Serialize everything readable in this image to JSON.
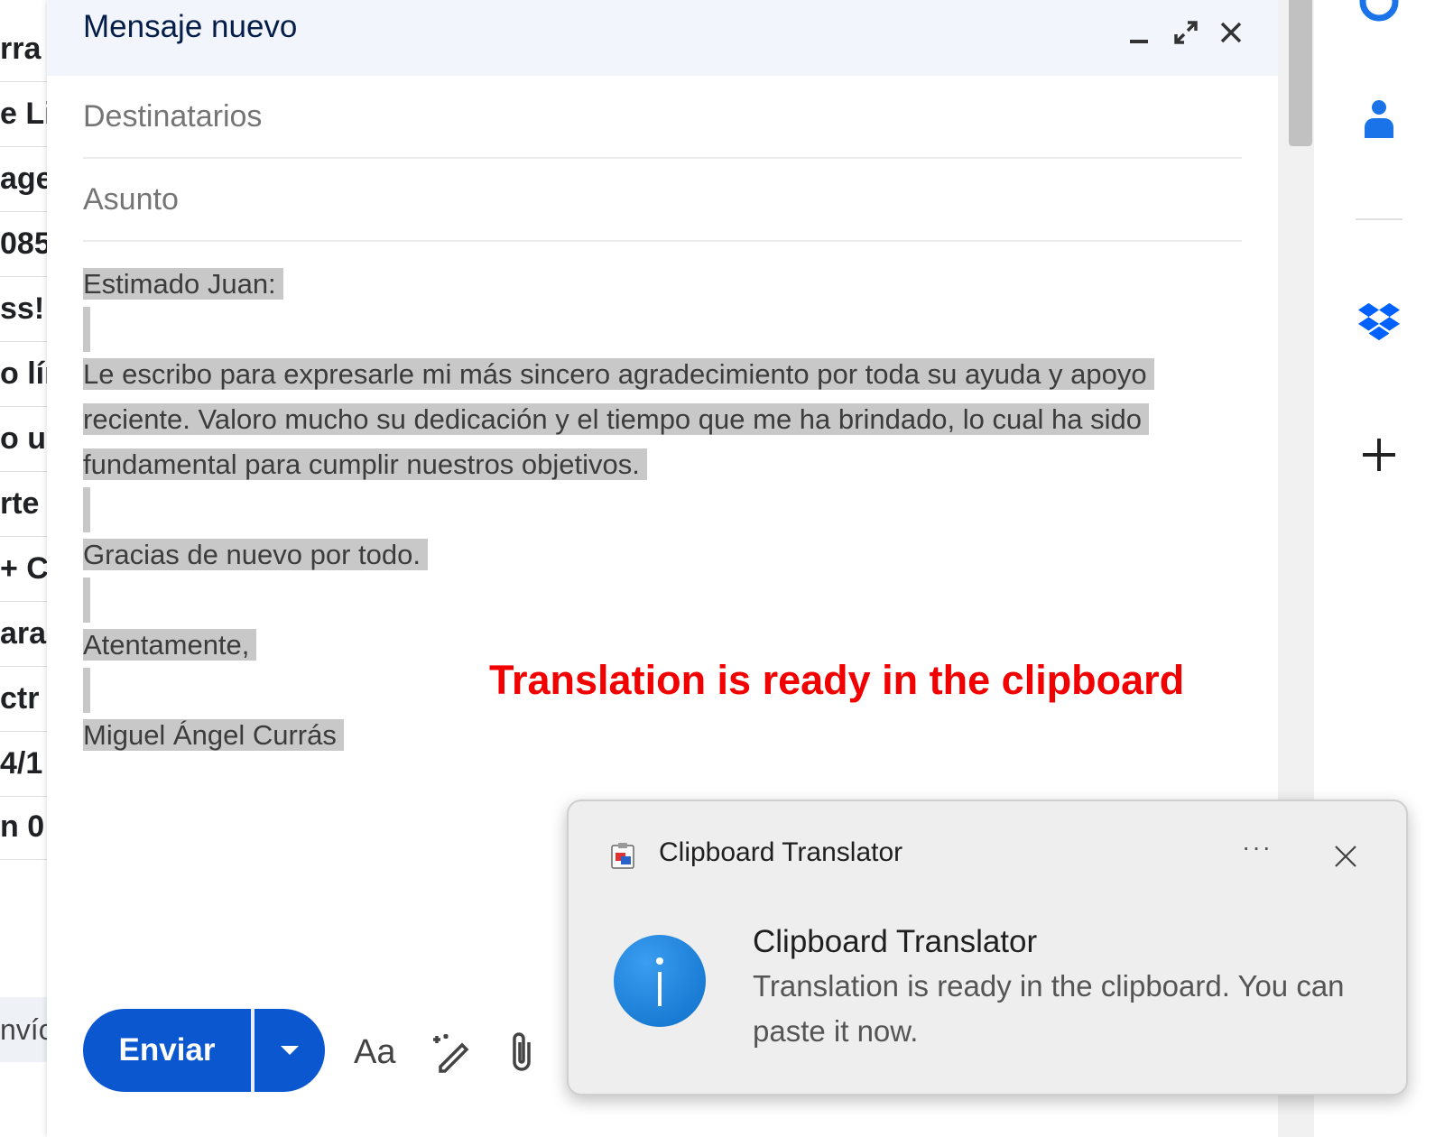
{
  "background_list": {
    "rows": [
      "rra d",
      "e Lin",
      "age",
      "085",
      "ss! -",
      "o lín",
      "o un",
      "rte",
      "+ C",
      "ara",
      "ctr",
      "4/1",
      "n 0"
    ],
    "bottom_text": "nvío"
  },
  "compose": {
    "title": "Mensaje nuevo",
    "recipients_placeholder": "Destinatarios",
    "subject_placeholder": "Asunto",
    "body_lines": [
      "Estimado Juan:",
      "",
      "Le escribo para expresarle mi más sincero agradecimiento por toda su ayuda y apoyo",
      "reciente. Valoro mucho su dedicación y el tiempo que me ha brindado, lo cual ha sido",
      "fundamental para cumplir nuestros objetivos.",
      "",
      "Gracias de nuevo por todo.",
      "",
      "Atentamente,",
      "",
      "Miguel Ángel Currás"
    ],
    "overlay_message": "Translation is ready in the clipboard",
    "send_label": "Enviar",
    "format_label": "Aa"
  },
  "toast": {
    "app_name": "Clipboard Translator",
    "more_label": "···",
    "title": "Clipboard Translator",
    "message": "Translation is ready in the clipboard. You can paste it now."
  },
  "colors": {
    "accent": "#0b57d0",
    "overlay_text": "#f20000",
    "selection": "#c8c8c8",
    "info_icon": "#1a7fd9"
  }
}
